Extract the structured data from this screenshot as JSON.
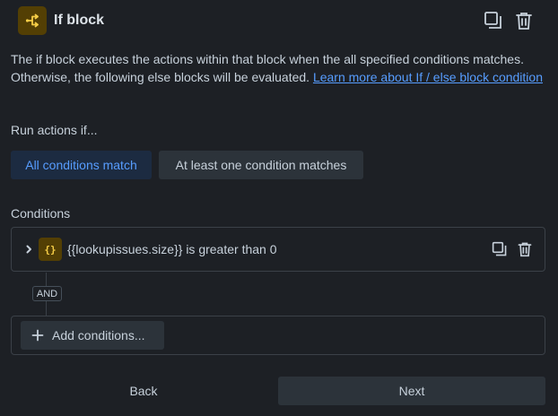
{
  "header": {
    "title": "If block",
    "icon": "branch-icon",
    "accent_color": "#533f04",
    "actions": [
      "duplicate-icon",
      "trash-icon"
    ]
  },
  "description": {
    "text": "The if block executes the actions within that block when the all specified conditions matches. Otherwise, the following else blocks will be evaluated. ",
    "link_text": "Learn more about If / else block condition"
  },
  "run_actions": {
    "label": "Run actions if...",
    "options": [
      {
        "label": "All conditions match",
        "selected": true
      },
      {
        "label": "At least one condition matches",
        "selected": false
      }
    ]
  },
  "conditions": {
    "label": "Conditions",
    "items": [
      {
        "icon_text": "{}",
        "text": "{{lookupissues.size}} is greater than 0"
      }
    ],
    "connector": "AND",
    "add_label": "Add conditions..."
  },
  "footer": {
    "back_label": "Back",
    "next_label": "Next"
  }
}
